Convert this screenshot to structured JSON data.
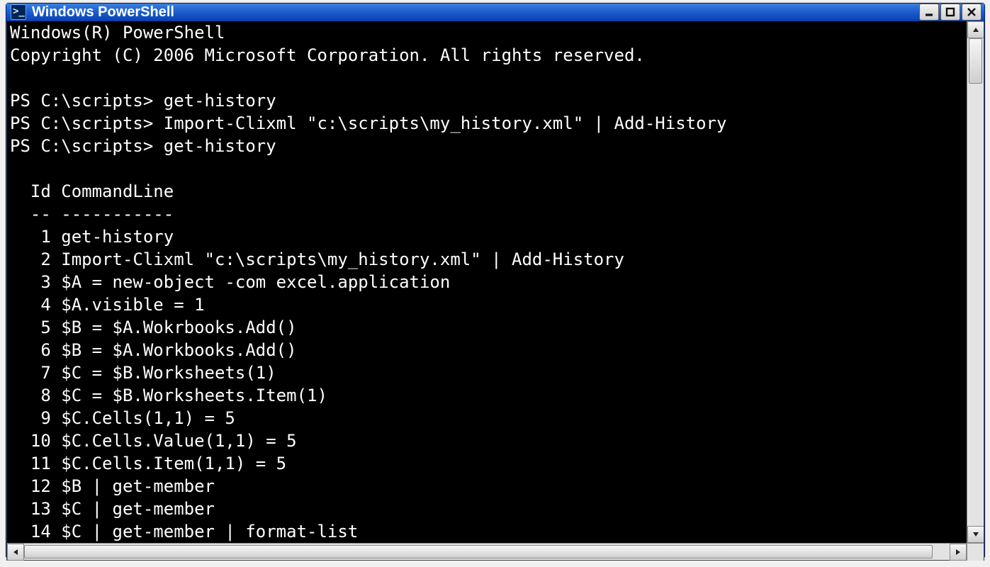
{
  "window": {
    "title": "Windows PowerShell"
  },
  "console": {
    "banner": [
      "Windows(R) PowerShell",
      "Copyright (C) 2006 Microsoft Corporation. All rights reserved."
    ],
    "prompts": [
      {
        "prompt": "PS C:\\scripts>",
        "cmd": "get-history"
      },
      {
        "prompt": "PS C:\\scripts>",
        "cmd": "Import-Clixml \"c:\\scripts\\my_history.xml\" | Add-History"
      },
      {
        "prompt": "PS C:\\scripts>",
        "cmd": "get-history"
      }
    ],
    "history_header": {
      "id": "Id",
      "cmd": "CommandLine",
      "rule_id": "--",
      "rule_cmd": "-----------"
    },
    "history": [
      {
        "id": 1,
        "cmd": "get-history"
      },
      {
        "id": 2,
        "cmd": "Import-Clixml \"c:\\scripts\\my_history.xml\" | Add-History"
      },
      {
        "id": 3,
        "cmd": "$A = new-object -com excel.application"
      },
      {
        "id": 4,
        "cmd": "$A.visible = 1"
      },
      {
        "id": 5,
        "cmd": "$B = $A.Wokrbooks.Add()"
      },
      {
        "id": 6,
        "cmd": "$B = $A.Workbooks.Add()"
      },
      {
        "id": 7,
        "cmd": "$C = $B.Worksheets(1)"
      },
      {
        "id": 8,
        "cmd": "$C = $B.Worksheets.Item(1)"
      },
      {
        "id": 9,
        "cmd": "$C.Cells(1,1) = 5"
      },
      {
        "id": 10,
        "cmd": "$C.Cells.Value(1,1) = 5"
      },
      {
        "id": 11,
        "cmd": "$C.Cells.Item(1,1) = 5"
      },
      {
        "id": 12,
        "cmd": "$B | get-member"
      },
      {
        "id": 13,
        "cmd": "$C | get-member"
      },
      {
        "id": 14,
        "cmd": "$C | get-member | format-list"
      }
    ]
  }
}
